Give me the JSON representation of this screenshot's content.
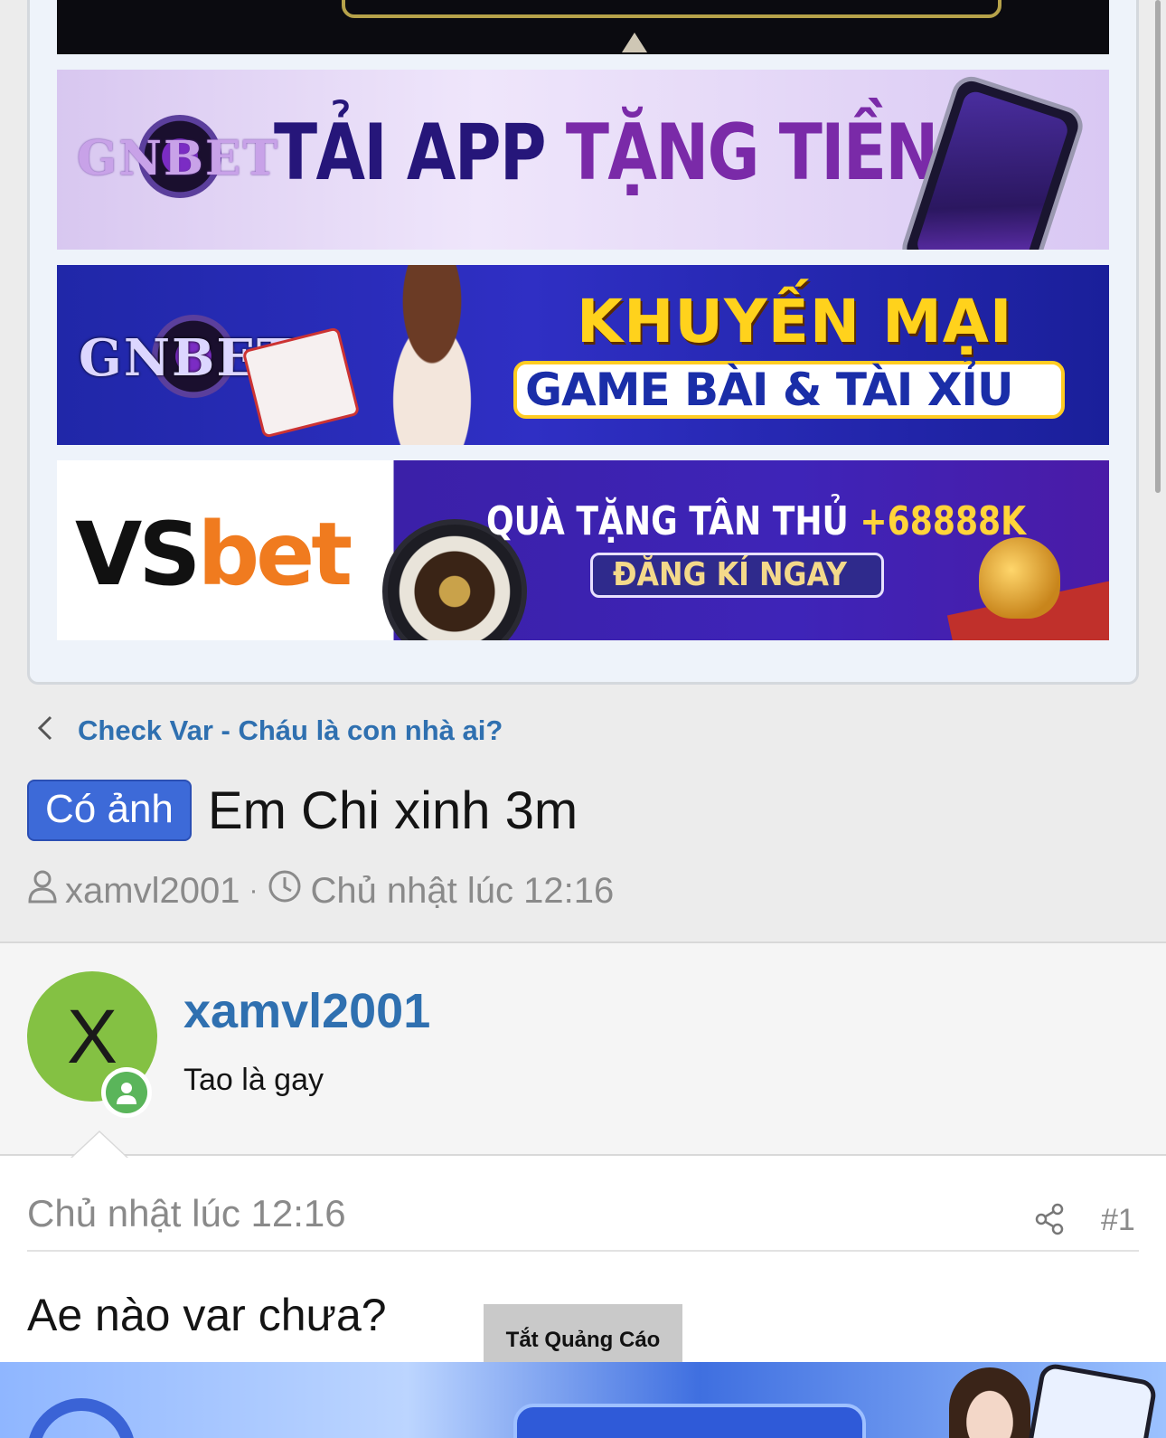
{
  "ads": {
    "banner1": {
      "logo": "GNBET",
      "headline_a": "TẢI APP",
      "headline_b": "TẶNG TIỀN"
    },
    "banner2": {
      "logo": "GNBET",
      "line1": "KHUYẾN MẠI",
      "line2": "GAME BÀI & TÀI XỈU"
    },
    "banner3": {
      "logo_a": "VS",
      "logo_b": "bet",
      "line1": "QUÀ TẶNG TÂN THỦ ",
      "amount": "+68888K",
      "cta": "ĐĂNG KÍ NGAY"
    },
    "close_label": "Tắt Quảng Cáo"
  },
  "breadcrumb": {
    "label": "Check Var - Cháu là con nhà ai?"
  },
  "thread": {
    "prefix": "Có ảnh",
    "title": "Em Chi xinh 3m",
    "author": "xamvl2001",
    "separator": "·",
    "date": "Chủ nhật lúc 12:16"
  },
  "post": {
    "avatar_letter": "X",
    "username": "xamvl2001",
    "user_title": "Tao là gay",
    "date": "Chủ nhật lúc 12:16",
    "number": "#1",
    "body": "Ae nào var chưa?"
  },
  "colors": {
    "link": "#2f70b0",
    "prefix_badge": "#3d6ad8",
    "avatar": "#84c143",
    "online": "#5ab55a"
  },
  "icons": [
    "user-icon",
    "clock-icon",
    "chevron-left-icon",
    "share-icon",
    "online-status-icon"
  ]
}
